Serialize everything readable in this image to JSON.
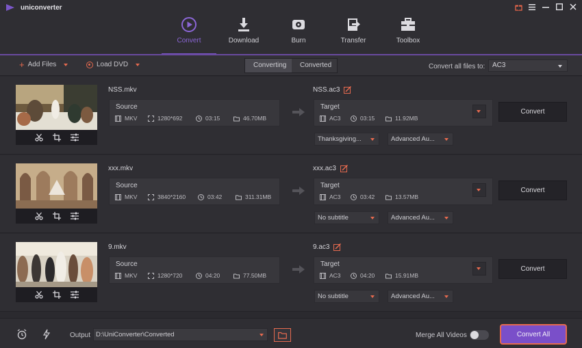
{
  "app": {
    "title": "uniconverter"
  },
  "colors": {
    "accent_purple": "#7a4fc9",
    "accent_orange": "#e66a4f",
    "background": "#2b2a2f"
  },
  "nav": [
    {
      "label": "Convert",
      "icon": "convert-icon",
      "active": true
    },
    {
      "label": "Download",
      "icon": "download-icon",
      "active": false
    },
    {
      "label": "Burn",
      "icon": "burn-icon",
      "active": false
    },
    {
      "label": "Transfer",
      "icon": "transfer-icon",
      "active": false
    },
    {
      "label": "Toolbox",
      "icon": "toolbox-icon",
      "active": false
    }
  ],
  "toolbar": {
    "add_files": "Add Files",
    "load_dvd": "Load DVD",
    "tab_converting": "Converting",
    "tab_converted": "Converted",
    "convert_all_label": "Convert all files to:",
    "convert_all_format": "AC3"
  },
  "files": [
    {
      "name": "NSS.mkv",
      "source": {
        "title": "Source",
        "format": "MKV",
        "resolution": "1280*692",
        "duration": "03:15",
        "size": "46.70MB"
      },
      "target_name": "NSS.ac3",
      "target": {
        "title": "Target",
        "format": "AC3",
        "duration": "03:15",
        "size": "11.92MB"
      },
      "subtitle": "Thanksgiving...",
      "advanced": "Advanced Au...",
      "convert": "Convert"
    },
    {
      "name": "xxx.mkv",
      "source": {
        "title": "Source",
        "format": "MKV",
        "resolution": "3840*2160",
        "duration": "03:42",
        "size": "311.31MB"
      },
      "target_name": "xxx.ac3",
      "target": {
        "title": "Target",
        "format": "AC3",
        "duration": "03:42",
        "size": "13.57MB"
      },
      "subtitle": "No subtitle",
      "advanced": "Advanced Au...",
      "convert": "Convert"
    },
    {
      "name": "9.mkv",
      "source": {
        "title": "Source",
        "format": "MKV",
        "resolution": "1280*720",
        "duration": "04:20",
        "size": "77.50MB"
      },
      "target_name": "9.ac3",
      "target": {
        "title": "Target",
        "format": "AC3",
        "duration": "04:20",
        "size": "15.91MB"
      },
      "subtitle": "No subtitle",
      "advanced": "Advanced Au...",
      "convert": "Convert"
    }
  ],
  "bottom": {
    "output_label": "Output",
    "output_path": "D:\\UniConverter\\Converted",
    "merge_label": "Merge All Videos",
    "merge_on": false,
    "convert_all": "Convert All"
  }
}
